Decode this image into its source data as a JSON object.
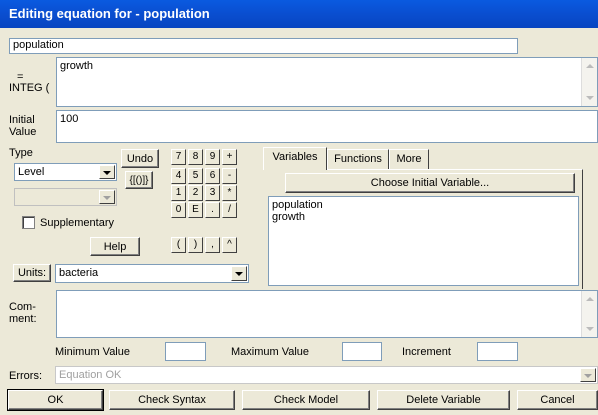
{
  "window": {
    "title": "Editing equation for - population"
  },
  "name_field": {
    "value": "population"
  },
  "equation": {
    "prefix_top": "=",
    "prefix_bottom": "INTEG (",
    "value": "growth"
  },
  "initial_value": {
    "label_top": "Initial",
    "label_bottom": "Value",
    "value": "100"
  },
  "type": {
    "label": "Type",
    "selected": "Level",
    "sub_selected": ""
  },
  "supplementary": {
    "label": "Supplementary",
    "checked": false
  },
  "keypad": {
    "undo": "Undo",
    "group": "{[()]}",
    "keys": [
      "7",
      "8",
      "9",
      "+",
      "4",
      "5",
      "6",
      "-",
      "1",
      "2",
      "3",
      "*",
      "0",
      "E",
      ".",
      "/",
      "(",
      ")",
      ",",
      "^"
    ],
    "help": "Help"
  },
  "tabs": [
    "Variables",
    "Functions",
    "More"
  ],
  "choose_button": "Choose Initial Variable...",
  "variables": [
    "population",
    "growth"
  ],
  "units": {
    "label": "Units:",
    "value": "bacteria"
  },
  "comment": {
    "label_top": "Com-",
    "label_bottom": "ment:",
    "value": ""
  },
  "range": {
    "min_label": "Minimum Value",
    "min_value": "",
    "max_label": "Maximum Value",
    "max_value": "",
    "inc_label": "Increment",
    "inc_value": ""
  },
  "errors": {
    "label": "Errors:",
    "value": "Equation OK"
  },
  "buttons": {
    "ok": "OK",
    "check_syntax": "Check Syntax",
    "check_model": "Check Model",
    "delete_variable": "Delete Variable",
    "cancel": "Cancel"
  }
}
